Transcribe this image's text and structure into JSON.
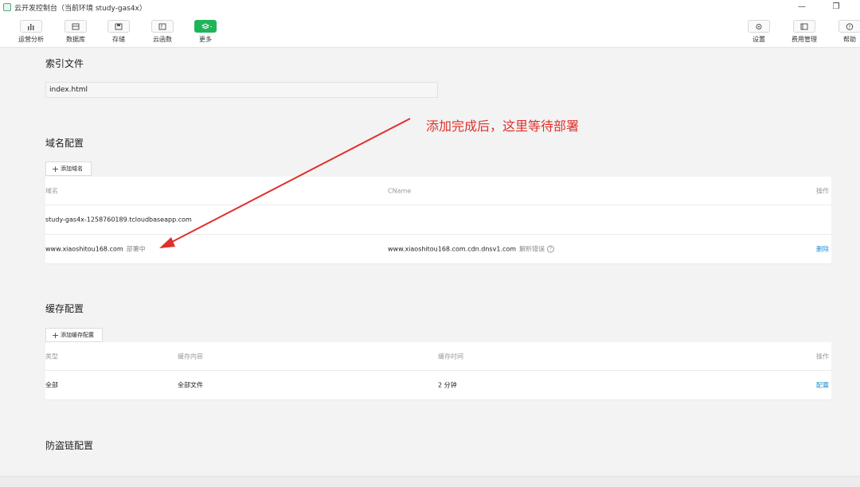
{
  "window": {
    "title": "云开发控制台（当前环境 study-gas4x）"
  },
  "toolbar": {
    "items": [
      {
        "label": "运营分析",
        "icon": "chart-icon"
      },
      {
        "label": "数据库",
        "icon": "database-icon"
      },
      {
        "label": "存储",
        "icon": "storage-icon"
      },
      {
        "label": "云函数",
        "icon": "function-icon"
      },
      {
        "label": "更多",
        "icon": "layers-icon"
      }
    ],
    "right_items": [
      {
        "label": "设置",
        "icon": "gear-icon"
      },
      {
        "label": "费用管理",
        "icon": "billing-icon"
      },
      {
        "label": "帮助",
        "icon": "help-icon"
      }
    ],
    "accent_color": "#20b45a"
  },
  "index_section": {
    "title": "索引文件",
    "value": "index.html"
  },
  "domain_section": {
    "title": "域名配置",
    "add_button": "添加域名",
    "headers": {
      "domain": "域名",
      "cname": "CName",
      "actions": "操作"
    },
    "rows": [
      {
        "domain": "study-gas4x-1258760189.tcloudbaseapp.com",
        "status": "",
        "cname": "",
        "cname_status": "",
        "action": ""
      },
      {
        "domain": "www.xiaoshitou168.com",
        "status": "部署中",
        "cname": "www.xiaoshitou168.com.cdn.dnsv1.com",
        "cname_status": "解析错误",
        "action": "删除"
      }
    ]
  },
  "cache_section": {
    "title": "缓存配置",
    "add_button": "添加缓存配置",
    "headers": {
      "type": "类型",
      "content": "缓存内容",
      "time": "缓存时间",
      "actions": "操作"
    },
    "rows": [
      {
        "type": "全部",
        "content": "全部文件",
        "time": "2 分钟",
        "action": "配置"
      }
    ]
  },
  "hotlink_section": {
    "title": "防盗链配置"
  },
  "annotation": {
    "text": "添加完成后，这里等待部署",
    "color": "#e0302a"
  }
}
